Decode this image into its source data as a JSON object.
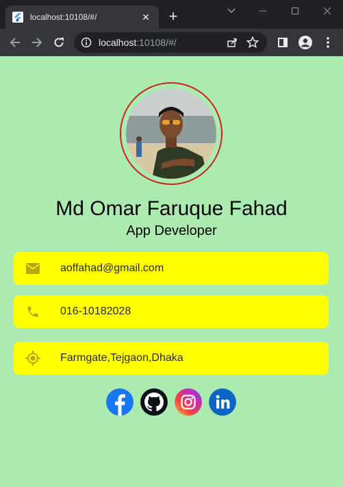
{
  "browser": {
    "tab_title": "localhost:10108/#/",
    "tab_close": "✕",
    "new_tab": "+",
    "url_host": "localhost",
    "url_rest": ":10108/#/"
  },
  "profile": {
    "name": "Md Omar Faruque Fahad",
    "role": "App Developer"
  },
  "contacts": {
    "email": "aoffahad@gmail.com",
    "phone": "016-10182028",
    "location": "Farmgate,Tejgaon,Dhaka"
  },
  "colors": {
    "background": "#abebb0",
    "card": "#ffff00",
    "icon": "#b5a816",
    "avatar_ring": "#d21f1f"
  },
  "icons": {
    "email": "email-icon",
    "phone": "phone-icon",
    "location": "location-icon",
    "socials": [
      "facebook-icon",
      "github-icon",
      "instagram-icon",
      "linkedin-icon"
    ]
  }
}
